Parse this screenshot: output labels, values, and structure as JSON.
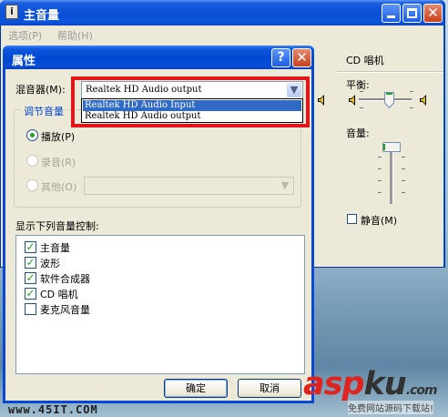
{
  "main_window": {
    "title": "主音量",
    "menu": [
      "选项(P)",
      "帮助(H)"
    ],
    "cd_column": {
      "title": "CD 唱机",
      "balance_label": "平衡:",
      "volume_label": "音量:",
      "mute_label": "静音(M)",
      "mute_checked": false
    }
  },
  "dialog": {
    "title": "属性",
    "help_label": "?",
    "close_label": "✕",
    "mixer_label": "混音器(M):",
    "mixer_value": "Realtek HD Audio output",
    "mixer_options": [
      "Realtek HD Audio Input",
      "Realtek HD Audio output"
    ],
    "mixer_highlighted_option": "Realtek HD Audio Input",
    "adjust_group_label": "调节音量",
    "radio_options": [
      {
        "label": "播放(P)",
        "selected": true,
        "enabled": true
      },
      {
        "label": "录音(R)",
        "selected": false,
        "enabled": false
      },
      {
        "label": "其他(O)",
        "selected": false,
        "enabled": false
      }
    ],
    "controls_label": "显示下列音量控制:",
    "controls": [
      {
        "label": "主音量",
        "checked": true
      },
      {
        "label": "波形",
        "checked": true
      },
      {
        "label": "软件合成器",
        "checked": true
      },
      {
        "label": "CD 唱机",
        "checked": true
      },
      {
        "label": "麦克风音量",
        "checked": false
      }
    ],
    "ok_label": "确定",
    "cancel_label": "取消"
  },
  "watermark": {
    "url": "www.45IT.COM",
    "brand_a": "asp",
    "brand_b": "ku",
    "brand_suffix": ".com",
    "brand_sub": "免费网站源码下载站!"
  },
  "colors": {
    "title_blue": "#0a4fd6",
    "dialog_face": "#ece9d8",
    "highlight_red": "#e2151a",
    "selection_blue": "#316ac5",
    "check_green": "#21a121"
  }
}
